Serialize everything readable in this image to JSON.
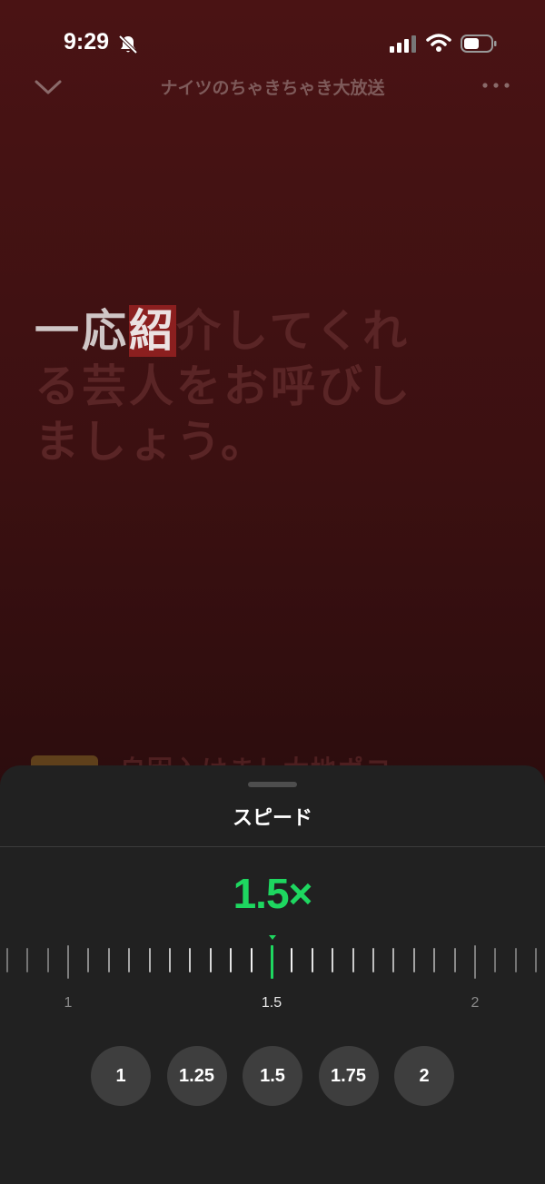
{
  "status_bar": {
    "time": "9:29",
    "icons": [
      "bell-slash-icon",
      "cellular-signal-icon",
      "wifi-icon",
      "battery-icon"
    ]
  },
  "header": {
    "title": "ナイツのちゃきちゃき大放送",
    "collapse_icon": "chevron-down-icon",
    "more_icon": "more-dots-icon"
  },
  "lyrics": {
    "line1_active": "一応",
    "line1_highlight": "紹",
    "line1_rest": "介してくれ",
    "line2": "る芸人をお呼びし",
    "line3": "ましょう。"
  },
  "next_item": {
    "text": "自因入けまし太地ポコ"
  },
  "speed_sheet": {
    "title": "スピード",
    "current_value": "1.5×",
    "ruler": {
      "min": 1,
      "max": 2,
      "step": 0.05,
      "current": 1.5,
      "labels": [
        "1",
        "1.5",
        "2"
      ]
    },
    "presets": [
      "1",
      "1.25",
      "1.5",
      "1.75",
      "2"
    ],
    "accent_color": "#1ed760"
  }
}
